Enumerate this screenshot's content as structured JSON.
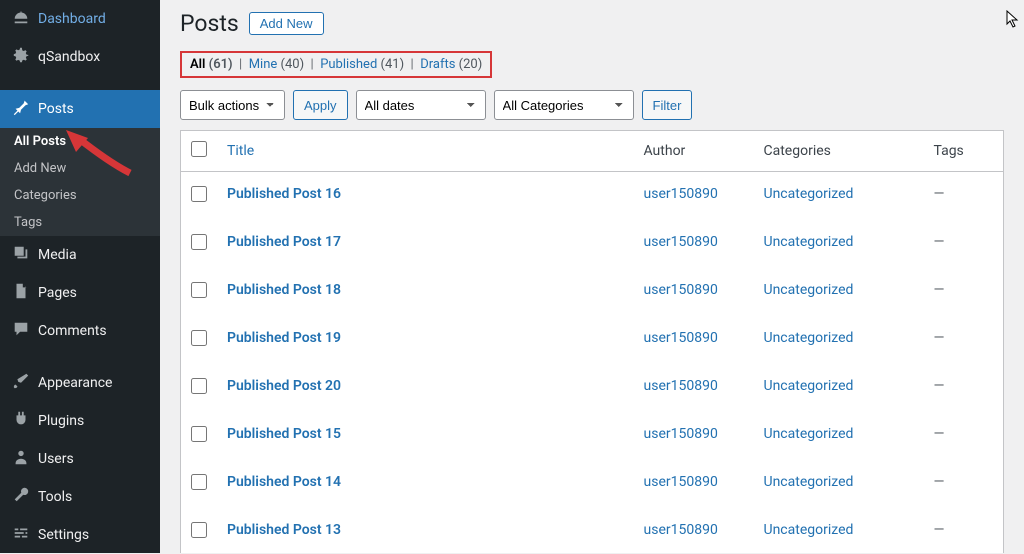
{
  "sidebar": {
    "items": [
      {
        "icon": "dashboard",
        "label": "Dashboard"
      },
      {
        "icon": "gear",
        "label": "qSandbox"
      },
      {
        "icon": "pin",
        "label": "Posts",
        "current": true,
        "submenu": [
          {
            "label": "All Posts",
            "current": true
          },
          {
            "label": "Add New"
          },
          {
            "label": "Categories"
          },
          {
            "label": "Tags"
          }
        ]
      },
      {
        "icon": "media",
        "label": "Media"
      },
      {
        "icon": "page",
        "label": "Pages"
      },
      {
        "icon": "comment",
        "label": "Comments"
      },
      {
        "icon": "appearance",
        "label": "Appearance"
      },
      {
        "icon": "plugin",
        "label": "Plugins"
      },
      {
        "icon": "user",
        "label": "Users"
      },
      {
        "icon": "wrench",
        "label": "Tools"
      },
      {
        "icon": "settings",
        "label": "Settings"
      }
    ]
  },
  "heading": {
    "title": "Posts",
    "add_new": "Add New"
  },
  "subsubsub": {
    "all": {
      "label": "All",
      "count": "(61)"
    },
    "mine": {
      "label": "Mine",
      "count": "(40)"
    },
    "published": {
      "label": "Published",
      "count": "(41)"
    },
    "drafts": {
      "label": "Drafts",
      "count": "(20)"
    }
  },
  "tablenav": {
    "bulk_actions": "Bulk actions",
    "apply": "Apply",
    "all_dates": "All dates",
    "all_categories": "All Categories",
    "filter": "Filter"
  },
  "columns": {
    "title": "Title",
    "author": "Author",
    "categories": "Categories",
    "tags": "Tags"
  },
  "posts": [
    {
      "title": "Published Post 16",
      "author": "user150890",
      "categories": "Uncategorized",
      "tags": "—"
    },
    {
      "title": "Published Post 17",
      "author": "user150890",
      "categories": "Uncategorized",
      "tags": "—"
    },
    {
      "title": "Published Post 18",
      "author": "user150890",
      "categories": "Uncategorized",
      "tags": "—"
    },
    {
      "title": "Published Post 19",
      "author": "user150890",
      "categories": "Uncategorized",
      "tags": "—"
    },
    {
      "title": "Published Post 20",
      "author": "user150890",
      "categories": "Uncategorized",
      "tags": "—"
    },
    {
      "title": "Published Post 15",
      "author": "user150890",
      "categories": "Uncategorized",
      "tags": "—"
    },
    {
      "title": "Published Post 14",
      "author": "user150890",
      "categories": "Uncategorized",
      "tags": "—"
    },
    {
      "title": "Published Post 13",
      "author": "user150890",
      "categories": "Uncategorized",
      "tags": "—"
    }
  ]
}
